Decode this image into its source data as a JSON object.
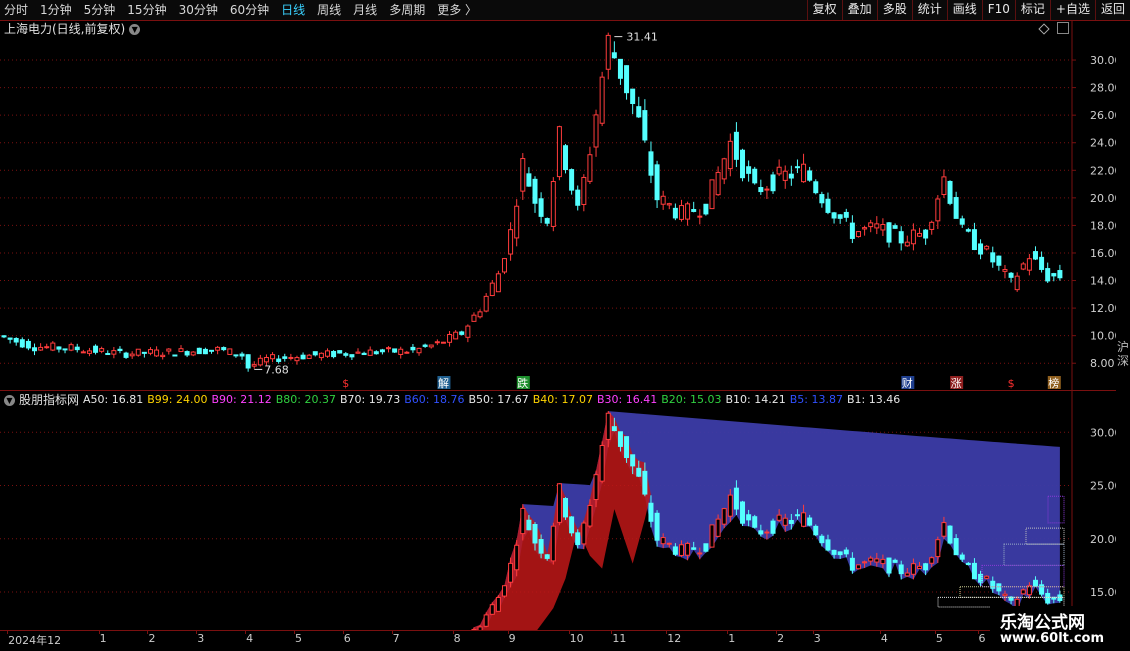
{
  "toolbar": {
    "periods": [
      "分时",
      "1分钟",
      "5分钟",
      "15分钟",
      "30分钟",
      "60分钟",
      "日线",
      "周线",
      "月线",
      "多周期",
      "更多 〉"
    ],
    "active_period": "日线",
    "right_buttons": [
      "复权",
      "叠加",
      "多股",
      "统计",
      "画线",
      "F10",
      "标记",
      "+自选",
      "返回"
    ]
  },
  "chart_title": "上海电力(日线,前复权)",
  "chart_title_icon": "chevron-down-icon",
  "price_axis": {
    "min": 7.0,
    "max": 31.6,
    "ticks": [
      "30.00",
      "28.00",
      "26.00",
      "24.00",
      "22.00",
      "20.00",
      "18.00",
      "16.00",
      "14.00",
      "12.00",
      "10.00",
      "8.00"
    ]
  },
  "annotations": {
    "high_label": "31.41",
    "low_label": "7.68"
  },
  "event_markers": [
    {
      "text": "$",
      "color": "#ff3030",
      "bg": "#000000",
      "idx": 56
    },
    {
      "text": "解",
      "color": "#ffffff",
      "bg": "#1f5f8f",
      "idx": 72
    },
    {
      "text": "跌",
      "color": "#ffffff",
      "bg": "#1c8f2c",
      "idx": 85
    },
    {
      "text": "财",
      "color": "#ffffff",
      "bg": "#1f3f8f",
      "idx": 148
    },
    {
      "text": "涨",
      "color": "#ffffff",
      "bg": "#8f1f1f",
      "idx": 156
    },
    {
      "text": "$",
      "color": "#ff3030",
      "bg": "#000000",
      "idx": 165
    },
    {
      "text": "榜",
      "color": "#ffffff",
      "bg": "#8f5f1f",
      "idx": 172
    }
  ],
  "indicator": {
    "name": "股朋指标网",
    "values": [
      {
        "label": "A50:",
        "value": "16.81",
        "color": "#e8e8e8"
      },
      {
        "label": "B99:",
        "value": "24.00",
        "color": "#ffd400"
      },
      {
        "label": "B90:",
        "value": "21.12",
        "color": "#ff40ff"
      },
      {
        "label": "B80:",
        "value": "20.37",
        "color": "#30d040"
      },
      {
        "label": "B70:",
        "value": "19.73",
        "color": "#e8e8e8"
      },
      {
        "label": "B60:",
        "value": "18.76",
        "color": "#3050ff"
      },
      {
        "label": "B50:",
        "value": "17.67",
        "color": "#e8e8e8"
      },
      {
        "label": "B40:",
        "value": "17.07",
        "color": "#ffd400"
      },
      {
        "label": "B30:",
        "value": "16.41",
        "color": "#ff40ff"
      },
      {
        "label": "B20:",
        "value": "15.03",
        "color": "#30d040"
      },
      {
        "label": "B10:",
        "value": "14.21",
        "color": "#e8e8e8"
      },
      {
        "label": "B5:",
        "value": "13.87",
        "color": "#3050ff"
      },
      {
        "label": "B1:",
        "value": "13.46",
        "color": "#e8e8e8"
      }
    ],
    "axis": {
      "min": 12.0,
      "max": 32.0,
      "ticks": [
        "30.00",
        "25.00",
        "20.00",
        "15.00"
      ]
    }
  },
  "date_axis": [
    {
      "text": "2024年12",
      "idx": 1
    },
    {
      "text": "1",
      "idx": 16
    },
    {
      "text": "2",
      "idx": 24
    },
    {
      "text": "3",
      "idx": 32
    },
    {
      "text": "4",
      "idx": 40
    },
    {
      "text": "5",
      "idx": 48
    },
    {
      "text": "6",
      "idx": 56
    },
    {
      "text": "7",
      "idx": 64
    },
    {
      "text": "8",
      "idx": 74
    },
    {
      "text": "9",
      "idx": 83
    },
    {
      "text": "10",
      "idx": 93
    },
    {
      "text": "11",
      "idx": 100
    },
    {
      "text": "12",
      "idx": 109
    },
    {
      "text": "1",
      "idx": 119
    },
    {
      "text": "2",
      "idx": 127
    },
    {
      "text": "3",
      "idx": 133
    },
    {
      "text": "4",
      "idx": 144
    },
    {
      "text": "5",
      "idx": 153
    },
    {
      "text": "6",
      "idx": 160
    }
  ],
  "right_strip_text": "沪深",
  "watermark": {
    "line1": "乐淘公式网",
    "line2": "www.60lt.com"
  },
  "colors": {
    "up": "#ff3c3c",
    "down": "#54ffff",
    "grid": "#7a1010",
    "band": "#3c3ca8",
    "fill": "#c01818"
  },
  "chart_data": {
    "type": "candlestick",
    "series_note_keys": [
      "price_path"
    ],
    "path_points": [
      [
        0,
        10.0
      ],
      [
        6,
        9.2
      ],
      [
        12,
        9.1
      ],
      [
        20,
        8.7
      ],
      [
        28,
        8.8
      ],
      [
        36,
        9.0
      ],
      [
        40,
        8.6
      ],
      [
        41,
        7.7
      ],
      [
        44,
        8.3
      ],
      [
        52,
        8.6
      ],
      [
        60,
        8.8
      ],
      [
        68,
        8.9
      ],
      [
        72,
        9.4
      ],
      [
        76,
        10.2
      ],
      [
        79,
        12.0
      ],
      [
        82,
        14.5
      ],
      [
        84,
        17.5
      ],
      [
        86,
        22.5
      ],
      [
        88,
        19.8
      ],
      [
        90,
        18.5
      ],
      [
        92,
        24.5
      ],
      [
        95,
        19.0
      ],
      [
        97,
        23.5
      ],
      [
        100,
        31.4
      ],
      [
        103,
        28.0
      ],
      [
        105,
        25.5
      ],
      [
        108,
        20.0
      ],
      [
        112,
        18.8
      ],
      [
        116,
        19.5
      ],
      [
        120,
        24.0
      ],
      [
        124,
        20.5
      ],
      [
        128,
        21.5
      ],
      [
        132,
        22.0
      ],
      [
        136,
        19.5
      ],
      [
        140,
        17.5
      ],
      [
        144,
        17.8
      ],
      [
        148,
        17.0
      ],
      [
        152,
        17.5
      ],
      [
        155,
        21.5
      ],
      [
        158,
        17.5
      ],
      [
        162,
        16.0
      ],
      [
        166,
        13.8
      ],
      [
        169,
        15.8
      ],
      [
        172,
        14.3
      ]
    ],
    "xlim": [
      0,
      174
    ]
  }
}
